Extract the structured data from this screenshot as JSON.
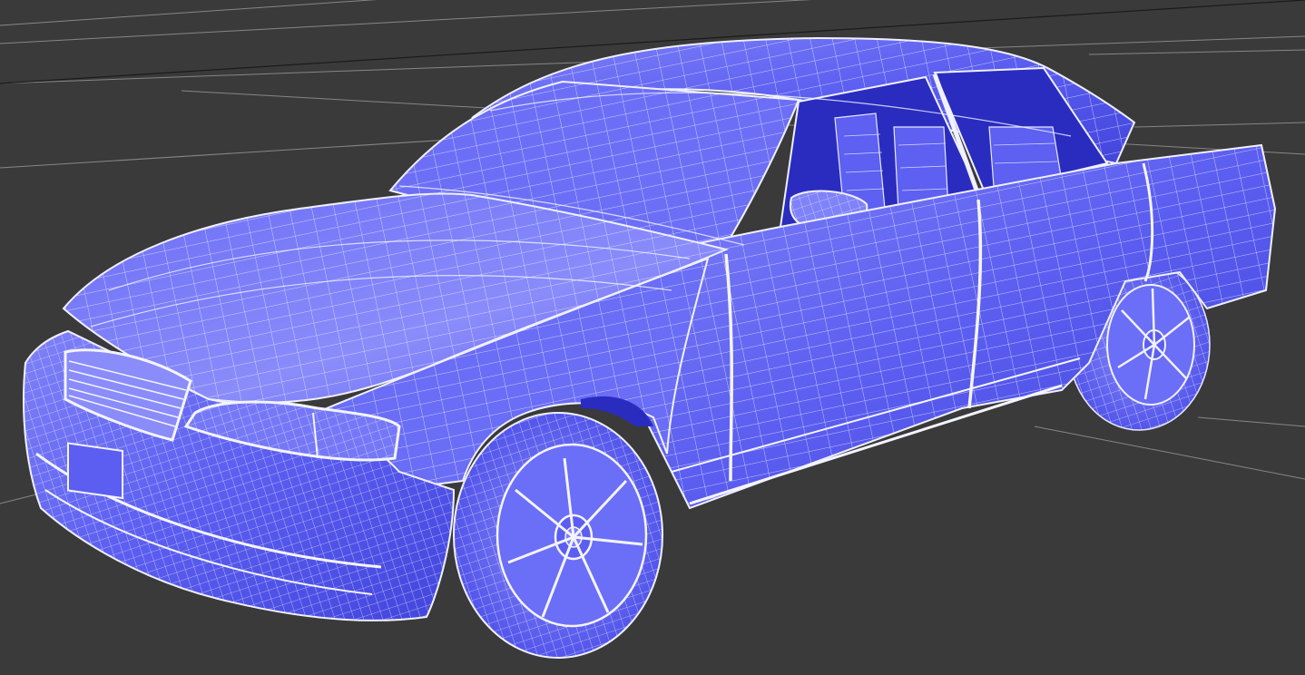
{
  "viewport": {
    "background": "#3a3a3a",
    "grid_color": "#9a9a9a",
    "grid_major_color": "#1a1a1a",
    "shading_mode": "wireframe-on-shaded"
  },
  "model": {
    "object_type": "sedan",
    "body_color": "#5b5ef0",
    "body_highlight": "#8e90fb",
    "body_shadow": "#3d40d8",
    "dark_fill": "#2a2cc0",
    "wire_color": "#e8e8ff"
  }
}
